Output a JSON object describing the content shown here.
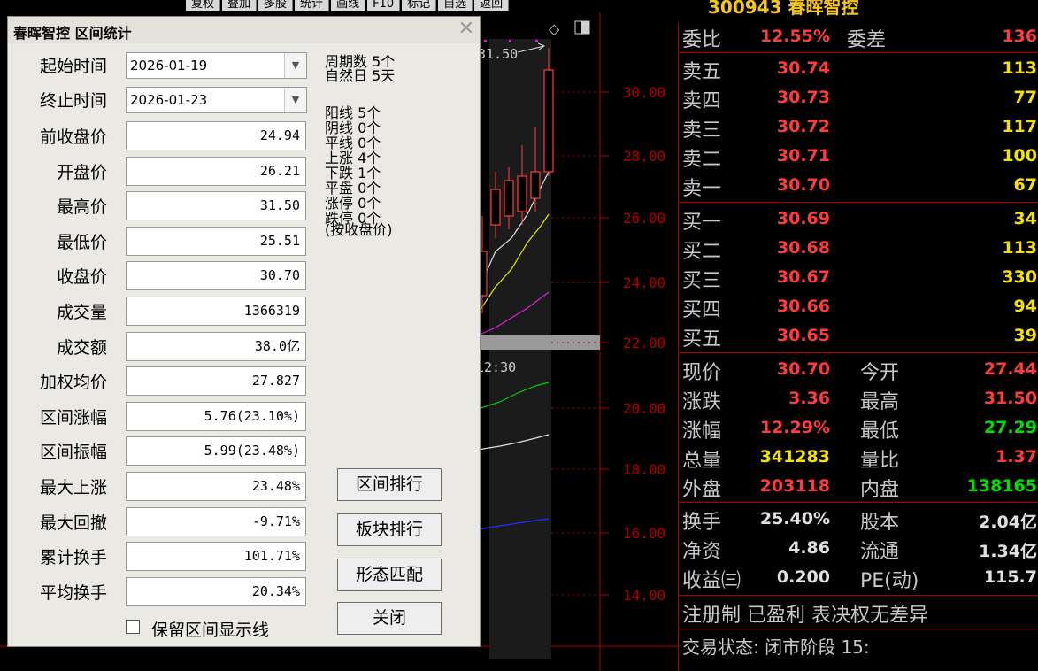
{
  "toolbar": [
    "复权",
    "叠加",
    "多股",
    "统计",
    "画线",
    "F10",
    "标记",
    "自选",
    "返回"
  ],
  "stock_title": "300943 春晖智控",
  "chart": {
    "price_ticks": [
      "30.00",
      "28.00",
      "26.00",
      "24.00",
      "22.00",
      "20.00",
      "18.00",
      "16.00",
      "14.00"
    ],
    "max_label": "31.50",
    "time_label": "12:30",
    "colors": {
      "candle": "#ff3c3c",
      "ma_white": "#e0e0e0",
      "ma_yellow": "#e6e600",
      "ma_magenta": "#e020e0",
      "ma_green": "#00d000",
      "ma_blue": "#2030ff",
      "axis": "#b00000"
    }
  },
  "dialog": {
    "title": "春晖智控 区间统计",
    "close": "✕",
    "start": {
      "label": "起始时间",
      "value": "2026-01-19"
    },
    "end": {
      "label": "终止时间",
      "value": "2026-01-23"
    },
    "fields": [
      {
        "label": "前收盘价",
        "value": "24.94"
      },
      {
        "label": "开盘价",
        "value": "26.21"
      },
      {
        "label": "最高价",
        "value": "31.50"
      },
      {
        "label": "最低价",
        "value": "25.51"
      },
      {
        "label": "收盘价",
        "value": "30.70"
      },
      {
        "label": "成交量",
        "value": "1366319"
      },
      {
        "label": "成交额",
        "value": "38.0亿"
      },
      {
        "label": "加权均价",
        "value": "27.827"
      },
      {
        "label": "区间涨幅",
        "value": "5.76(23.10%)"
      },
      {
        "label": "区间振幅",
        "value": "5.99(23.48%)"
      },
      {
        "label": "最大上涨",
        "value": "23.48%"
      },
      {
        "label": "最大回撤",
        "value": "-9.71%"
      },
      {
        "label": "累计换手",
        "value": "101.71%"
      },
      {
        "label": "平均换手",
        "value": "20.34%"
      }
    ],
    "stats": [
      "周期数 5个",
      "自然日 5天",
      "阳线 5个",
      "阴线 0个",
      "平线 0个",
      "上涨 4个",
      "下跌 1个",
      "平盘 0个",
      "涨停 0个",
      "跌停 0个",
      "(按收盘价)"
    ],
    "buttons": [
      "区间排行",
      "板块排行",
      "形态匹配",
      "关闭"
    ],
    "keep_lines_label": "保留区间显示线"
  },
  "quote": {
    "weibi": {
      "label": "委比",
      "value": "12.55%",
      "label2": "委差",
      "value2": "136"
    },
    "asks": [
      {
        "label": "卖五",
        "price": "30.74",
        "vol": "113"
      },
      {
        "label": "卖四",
        "price": "30.73",
        "vol": "77"
      },
      {
        "label": "卖三",
        "price": "30.72",
        "vol": "117"
      },
      {
        "label": "卖二",
        "price": "30.71",
        "vol": "100"
      },
      {
        "label": "卖一",
        "price": "30.70",
        "vol": "67"
      }
    ],
    "bids": [
      {
        "label": "买一",
        "price": "30.69",
        "vol": "34"
      },
      {
        "label": "买二",
        "price": "30.68",
        "vol": "113"
      },
      {
        "label": "买三",
        "price": "30.67",
        "vol": "330"
      },
      {
        "label": "买四",
        "price": "30.66",
        "vol": "94"
      },
      {
        "label": "买五",
        "price": "30.65",
        "vol": "39"
      }
    ],
    "info": [
      {
        "l1": "现价",
        "v1": "30.70",
        "c1": "#ff3c3c",
        "l2": "今开",
        "v2": "27.44",
        "c2": "#ff3c3c"
      },
      {
        "l1": "涨跌",
        "v1": "3.36",
        "c1": "#ff3c3c",
        "l2": "最高",
        "v2": "31.50",
        "c2": "#ff3c3c"
      },
      {
        "l1": "涨幅",
        "v1": "12.29%",
        "c1": "#ff3c3c",
        "l2": "最低",
        "v2": "27.29",
        "c2": "#00e000"
      },
      {
        "l1": "总量",
        "v1": "341283",
        "c1": "#f5e000",
        "l2": "量比",
        "v2": "1.37",
        "c2": "#ff3c3c"
      },
      {
        "l1": "外盘",
        "v1": "203118",
        "c1": "#ff3c3c",
        "l2": "内盘",
        "v2": "138165",
        "c2": "#00e000"
      }
    ],
    "info2": [
      {
        "l1": "换手",
        "v1": "25.40%",
        "l2": "股本",
        "v2": "2.04亿"
      },
      {
        "l1": "净资",
        "v1": "4.86",
        "l2": "流通",
        "v2": "1.34亿"
      },
      {
        "l1": "收益㈢",
        "v1": "0.200",
        "l2": "PE(动)",
        "v2": "115.7"
      }
    ],
    "notes": [
      "注册制 已盈利 表决权无差异",
      "交易状态: 闭市阶段 15:"
    ]
  }
}
